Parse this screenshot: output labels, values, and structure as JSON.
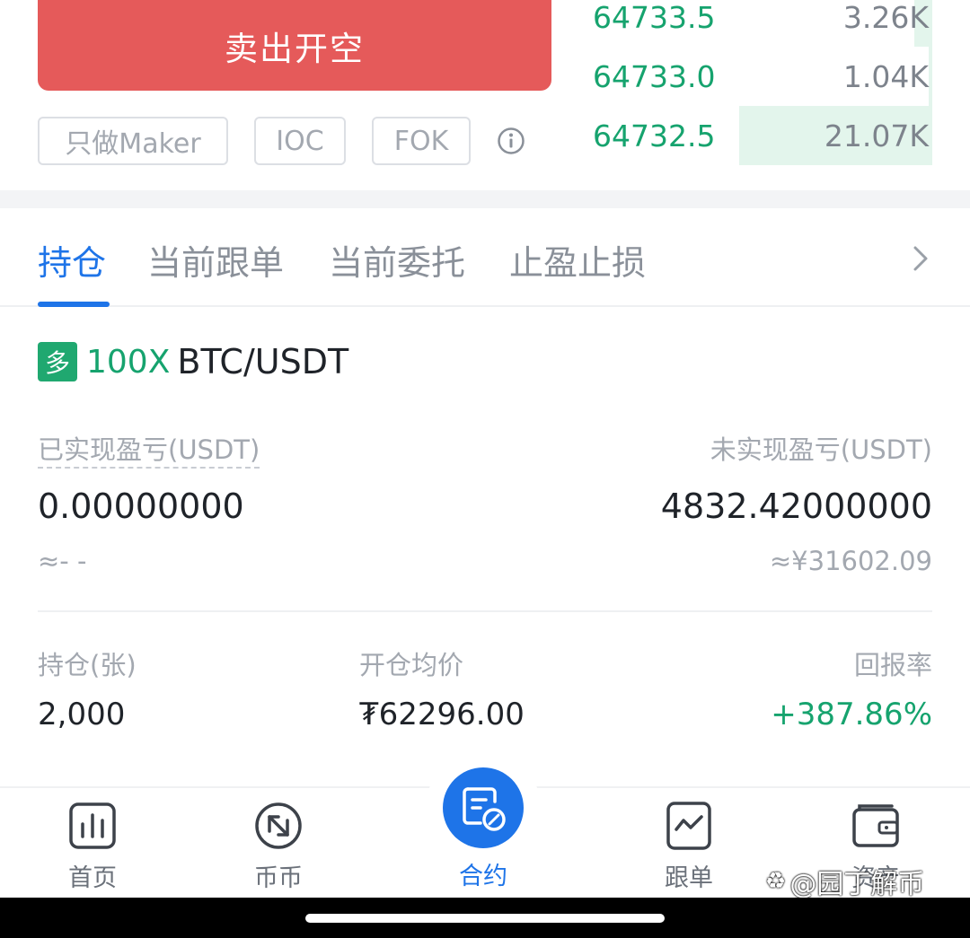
{
  "trade": {
    "sell_short_label": "卖出开空",
    "options": [
      "只做Maker",
      "IOC",
      "FOK"
    ]
  },
  "orderbook": {
    "rows": [
      {
        "price": "64733.5",
        "qty": "3.26K",
        "depth": 0.05
      },
      {
        "price": "64733.0",
        "qty": "1.04K",
        "depth": 0.01
      },
      {
        "price": "64732.5",
        "qty": "21.07K",
        "depth": 0.54
      }
    ]
  },
  "tabs": [
    "持仓",
    "当前跟单",
    "当前委托",
    "止盈止损"
  ],
  "position": {
    "direction": "多",
    "leverage": "100X",
    "symbol": "BTC/USDT",
    "realized_label": "已实现盈亏(USDT)",
    "realized_value": "0.00000000",
    "realized_cny": "≈- -",
    "unrealized_label": "未实现盈亏(USDT)",
    "unrealized_value": "4832.42000000",
    "unrealized_cny": "≈¥31602.09",
    "size_label": "持仓(张)",
    "size_value": "2,000",
    "entry_label": "开仓均价",
    "entry_value": "₮62296.00",
    "roe_label": "回报率",
    "roe_value": "+387.86%"
  },
  "nav": {
    "items": [
      "首页",
      "币币",
      "合约",
      "跟单",
      "资产"
    ]
  },
  "watermark": "@园丁解币",
  "colors": {
    "sell": "#e55a5a",
    "buy_green": "#16a36e",
    "accent_blue": "#1e74e8"
  }
}
